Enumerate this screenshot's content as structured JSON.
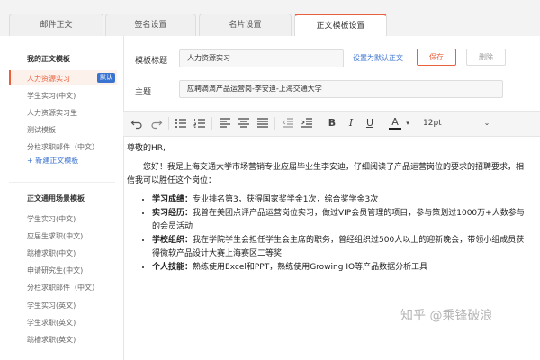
{
  "tabs": [
    {
      "label": "邮件正文"
    },
    {
      "label": "签名设置"
    },
    {
      "label": "名片设置"
    },
    {
      "label": "正文模板设置"
    }
  ],
  "sidebar": {
    "my_templates_title": "我的正文模板",
    "my_templates": [
      {
        "label": "人力资源实习"
      },
      {
        "label": "学生实习(中文)"
      },
      {
        "label": "人力资源实习生"
      },
      {
        "label": "测试模板"
      },
      {
        "label": "分栏求职邮件（中文）"
      }
    ],
    "default_badge": "默认",
    "new_template": "+  新建正文模板",
    "common_title": "正文通用场景模板",
    "common_templates": [
      {
        "label": "学生实习(中文)"
      },
      {
        "label": "应届生求职(中文)"
      },
      {
        "label": "跳槽求职(中文)"
      },
      {
        "label": "申请研究生(中文)"
      },
      {
        "label": "分栏求职邮件（中文）"
      },
      {
        "label": "学生实习(英文)"
      },
      {
        "label": "学生求职(英文)"
      },
      {
        "label": "跳槽求职(英文)"
      }
    ]
  },
  "form": {
    "title_label": "模板标题",
    "title_value": "人力资源实习",
    "subject_label": "主题",
    "subject_value": "应聘滴滴产品运营岗-李安迪-上海交通大学",
    "set_default": "设置为默认正文",
    "save": "保存",
    "delete": "删除"
  },
  "toolbar": {
    "font_size": "12pt",
    "bold": "B",
    "italic": "I",
    "underline": "U",
    "font_color": "A",
    "icons": [
      "undo-icon",
      "redo-icon",
      "bullet-list-icon",
      "numbered-list-icon",
      "align-left-icon",
      "align-center-icon",
      "align-justify-icon",
      "outdent-icon",
      "indent-icon",
      "bold-icon",
      "italic-icon",
      "underline-icon",
      "font-color-icon",
      "font-size-icon"
    ]
  },
  "editor": {
    "greeting": "尊敬的HR,",
    "intro": "您好！我是上海交通大学市场营销专业应届毕业生李安迪，仔细阅读了产品运营岗位的要求的招聘要求，相信我可以胜任这个岗位：",
    "bullets": [
      {
        "label": "学习成绩：",
        "text": "专业排名第3，获得国家奖学金1次，综合奖学金3次"
      },
      {
        "label": "实习经历：",
        "text": "我曾在美团点评产品运营岗位实习，做过VIP会员管理的项目，参与策划过1000万+人数参与的会员活动"
      },
      {
        "label": "学校组织：",
        "text": "我在学院学生会担任学生会主席的职务，曾经组织过500人以上的迎新晚会，带领小组成员获得微软产品设计大赛上海赛区二等奖"
      },
      {
        "label": "个人技能：",
        "text": "熟练使用Excel和PPT，熟练使用Growing IO等产品数据分析工具"
      }
    ]
  },
  "watermark": "知乎 @乘锋破浪",
  "colors": {
    "accent": "#e8603c",
    "link": "#3b73d0"
  }
}
